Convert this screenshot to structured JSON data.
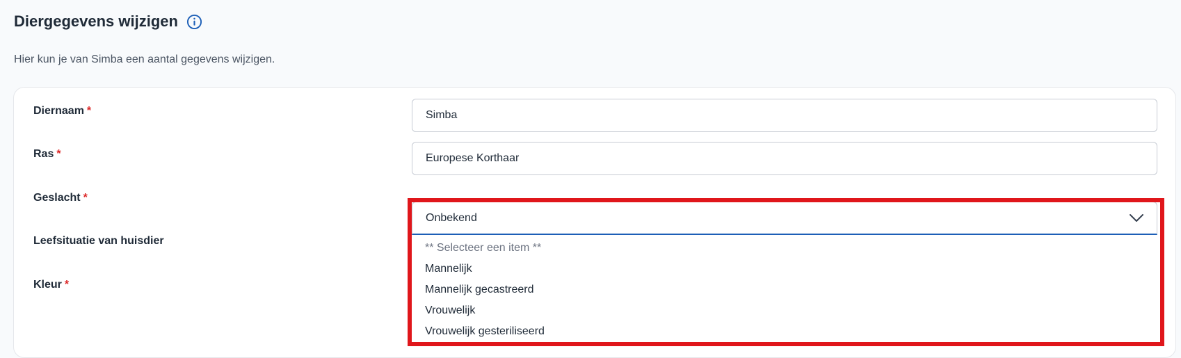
{
  "header": {
    "title": "Diergegevens wijzigen",
    "info_icon": "info-circle-icon",
    "subtitle": "Hier kun je van Simba een aantal gegevens wijzigen."
  },
  "form": {
    "required_marker": "*",
    "name": {
      "label": "Diernaam",
      "value": "Simba"
    },
    "breed": {
      "label": "Ras",
      "value": "Europese Korthaar"
    },
    "gender": {
      "label": "Geslacht",
      "selected": "Onbekend",
      "chevron_icon": "chevron-down-icon",
      "options": [
        "** Selecteer een item **",
        "Mannelijk",
        "Mannelijk gecastreerd",
        "Vrouwelijk",
        "Vrouwelijk gesteriliseerd"
      ]
    },
    "living_situation": {
      "label": "Leefsituatie van huisdier"
    },
    "color": {
      "label": "Kleur"
    }
  },
  "colors": {
    "title_text": "#1f2a37",
    "accent_blue": "#1d5fb7",
    "required_red": "#dc2626",
    "highlight_red": "#e0161b",
    "page_background": "#f8fafc"
  }
}
